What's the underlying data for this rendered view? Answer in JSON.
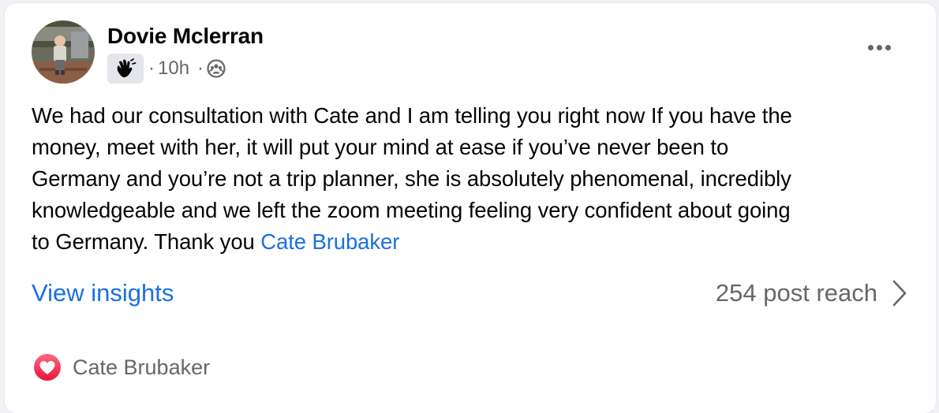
{
  "post": {
    "author": "Dovie Mclerran",
    "meta": {
      "badge_icon": "waving-hand-icon",
      "separator": "·",
      "time": "10h",
      "audience_icon": "groups-audience-icon"
    },
    "text_lines": [
      "We had our consultation with Cate and I am telling you right now If you have the",
      "money, meet with her, it will put your mind at ease if you’ve never been to",
      "Germany and you’re not a trip planner, she is absolutely phenomenal, incredibly",
      "knowledgeable and we left the zoom meeting feeling very confident about going",
      "to Germany. Thank you "
    ],
    "mention": "Cate Brubaker",
    "more_icon": "more-horizontal-icon"
  },
  "insights": {
    "link_label": "View insights",
    "reach_label": "254 post reach"
  },
  "reactions": {
    "icon": "love-reaction-icon",
    "names": "Cate Brubaker"
  },
  "colors": {
    "link_blue": "#1b6fe0",
    "secondary_text": "#65676b",
    "love_red": "#f0435a"
  }
}
